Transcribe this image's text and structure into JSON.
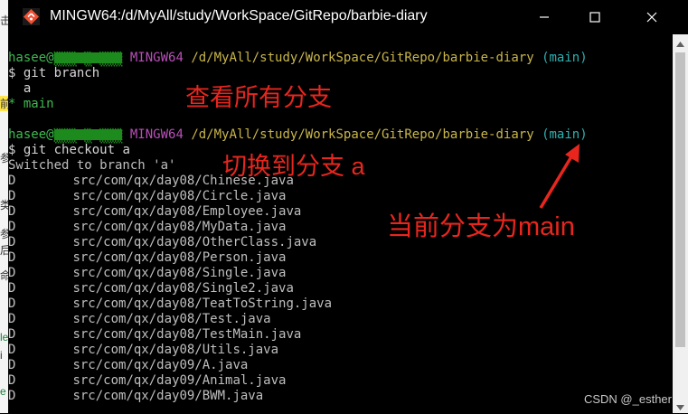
{
  "window": {
    "title": "MINGW64:/d/MyAll/study/WorkSpace/GitRepo/barbie-diary",
    "icons": {
      "app": "git-bash-icon",
      "minimize": "minimize-icon",
      "maximize": "maximize-icon",
      "close": "close-icon"
    }
  },
  "background_window": {
    "fragments": [
      "击",
      "前",
      "参",
      "类",
      "参",
      "后",
      "命",
      "le",
      "i",
      "e"
    ]
  },
  "prompt": {
    "user": "hasee@",
    "host_hidden": "▒▒▒a▒i▒▒▒",
    "shell": "MINGW64",
    "path": "/d/MyAll/study/WorkSpace/GitRepo/barbie-diary",
    "branch": "(main)",
    "symbol": "$"
  },
  "commands": {
    "branch_cmd": "git branch",
    "checkout_cmd": "git checkout a"
  },
  "branches": [
    {
      "marker": " ",
      "name": "a"
    },
    {
      "marker": "*",
      "name": "main"
    }
  ],
  "switched_msg": "Switched to branch 'a'",
  "deleted_files": {
    "status": "D",
    "files": [
      "src/com/qx/day08/Chinese.java",
      "src/com/qx/day08/Circle.java",
      "src/com/qx/day08/Employee.java",
      "src/com/qx/day08/MyData.java",
      "src/com/qx/day08/OtherClass.java",
      "src/com/qx/day08/Person.java",
      "src/com/qx/day08/Single.java",
      "src/com/qx/day08/Single2.java",
      "src/com/qx/day08/TeatToString.java",
      "src/com/qx/day08/Test.java",
      "src/com/qx/day08/TestMain.java",
      "src/com/qx/day08/Utils.java",
      "src/com/qx/day09/A.java",
      "src/com/qx/day09/Animal.java",
      "src/com/qx/day09/BWM.java"
    ]
  },
  "annotations": {
    "view_branches": "查看所有分支",
    "switch_branch": "切换到分支 a",
    "current_branch": "当前分支为main"
  },
  "watermark": "CSDN @_esther",
  "colors": {
    "annotation_red": "#e8261e",
    "prompt_green": "#3fb950",
    "prompt_magenta": "#b84fb8",
    "path_yellow": "#c9b64a",
    "branch_cyan": "#2fb1b1"
  }
}
